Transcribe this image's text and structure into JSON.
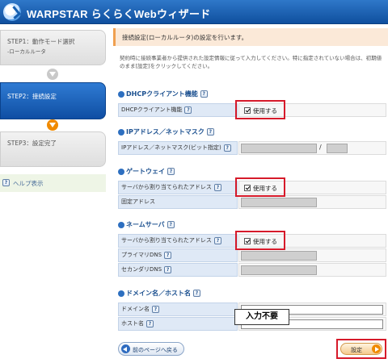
{
  "header": {
    "title": "WARPSTAR らくらくWebウィザード"
  },
  "sidebar": {
    "steps": [
      {
        "label": "STEP1：動作モード選択",
        "sub": "-ローカルルータ"
      },
      {
        "label": "STEP2：接続設定"
      },
      {
        "label": "STEP3：設定完了"
      }
    ],
    "help_label": "ヘルプ表示"
  },
  "main": {
    "notice": "接続設定(ローカルルータ)の設定を行います。",
    "description": "契約時に接続事業者から提供された設定情報に従って入力してください。特に指定されていない場合は、初期値のまま[設定]をクリックしてください。",
    "sections": {
      "dhcp": {
        "title": "DHCPクライアント機能",
        "row_label": "DHCPクライアント機能",
        "checkbox_label": "使用する",
        "checked": true
      },
      "ip": {
        "title": "IPアドレス／ネットマスク",
        "row_label": "IPアドレス／ネットマスク(ビット指定)",
        "separator": "/"
      },
      "gateway": {
        "title": "ゲートウェイ",
        "row1_label": "サーバから割り当てられたアドレス",
        "checkbox_label": "使用する",
        "checked": true,
        "row2_label": "固定アドレス"
      },
      "nameserver": {
        "title": "ネームサーバ",
        "row1_label": "サーバから割り当てられたアドレス",
        "checkbox_label": "使用する",
        "checked": true,
        "row2_label": "プライマリDNS",
        "row3_label": "セカンダリDNS"
      },
      "domain": {
        "title": "ドメイン名／ホスト名",
        "row1_label": "ドメイン名",
        "row2_label": "ホスト名"
      }
    },
    "callout": "入力不要",
    "back_button": "前のページへ戻る",
    "set_button": "設定"
  },
  "help_icon": "?",
  "colors": {
    "header": "#1a5fb4",
    "highlight": "#d61a2a",
    "accent_orange": "#f08a00",
    "label_bg": "#dfe9f6"
  }
}
